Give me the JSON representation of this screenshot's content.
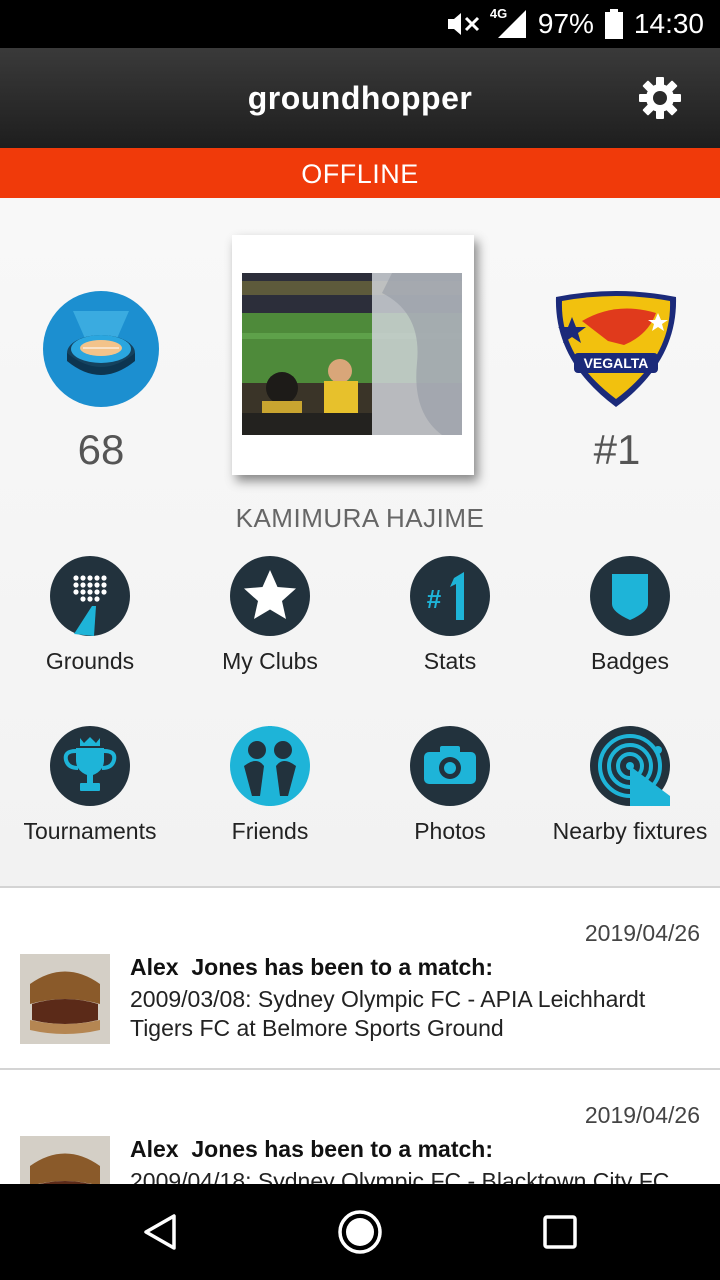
{
  "status_bar": {
    "network": "4G",
    "battery": "97%",
    "time": "14:30",
    "icons": [
      "mute-icon",
      "signal-icon",
      "battery-icon"
    ]
  },
  "app_bar": {
    "title": "groundhopper",
    "settings_icon": "gear-icon"
  },
  "banner": {
    "text": "OFFLINE",
    "color": "#f03a0a"
  },
  "profile": {
    "grounds_count": "68",
    "rank": "#1",
    "name": "KAMIMURA HAJIME",
    "club_badge_text": "VEGALTA"
  },
  "menu": [
    {
      "label": "Grounds",
      "icon": "grounds-icon"
    },
    {
      "label": "My Clubs",
      "icon": "star-icon"
    },
    {
      "label": "Stats",
      "icon": "rank-one-icon"
    },
    {
      "label": "Badges",
      "icon": "badge-shield-icon"
    },
    {
      "label": "Tournaments",
      "icon": "trophy-icon"
    },
    {
      "label": "Friends",
      "icon": "friends-icon"
    },
    {
      "label": "Photos",
      "icon": "camera-icon"
    },
    {
      "label": "Nearby fixtures",
      "icon": "nearby-signal-icon"
    }
  ],
  "feed": [
    {
      "date": "2019/04/26",
      "title": "Alex  Jones has been to a match:",
      "text": "2009/03/08: Sydney Olympic FC - APIA Leichhardt Tigers FC at Belmore Sports Ground"
    },
    {
      "date": "2019/04/26",
      "title": "Alex  Jones has been to a match:",
      "text": "2009/04/18: Sydney Olympic FC - Blacktown City FC"
    }
  ],
  "nav_bar": {
    "icons": [
      "back-icon",
      "home-icon",
      "recents-icon"
    ]
  },
  "colors": {
    "accent": "#1eb4d8",
    "icon_bg": "#22323d",
    "offline": "#f03a0a"
  }
}
